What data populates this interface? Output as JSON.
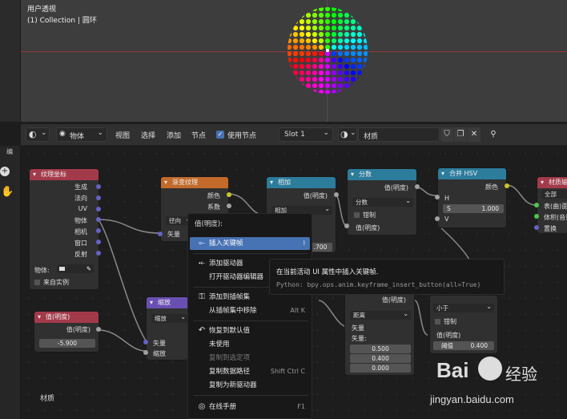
{
  "viewport": {
    "title": "用户透视",
    "subtitle": "(1) Collection | 圆环"
  },
  "header": {
    "editor_type_icon": "node-editor-icon",
    "object_label": "物体",
    "menu_view": "视图",
    "menu_select": "选择",
    "menu_add": "添加",
    "menu_node": "节点",
    "use_nodes_label": "使用节点",
    "use_nodes_checked": true,
    "slot_label": "Slot 1",
    "material_name": "材质"
  },
  "left_toolbar": {
    "item_label": "编"
  },
  "nodes": {
    "texcoord": {
      "title": "纹理坐标",
      "outputs": [
        "生成",
        "法向",
        "UV",
        "物体",
        "相机",
        "窗口",
        "反射"
      ],
      "object_label": "物体:",
      "instancer_label": "来自实例",
      "color": "#a33a4a"
    },
    "gradient": {
      "title": "渐变纹理",
      "outputs": [
        "颜色",
        "系数"
      ],
      "type_value": "径向",
      "input": "矢量",
      "color": "#c26a2a"
    },
    "value1": {
      "title": "值(明度)",
      "output": "值(明度)",
      "value": "-5.900",
      "color": "#a33a4a"
    },
    "scale": {
      "title": "缩放",
      "mode": "缩放",
      "inputs": [
        "矢量",
        "缩放"
      ],
      "color": "#6a4fb3"
    },
    "add": {
      "title": "相加",
      "output": "值(明度)",
      "mode": "相加",
      "value_field": ".700",
      "color": "#2c7c9c"
    },
    "fraction": {
      "title": "分数",
      "output": "值(明度)",
      "mode": "分数",
      "clamp_label": "钳制",
      "input": "值(明度)",
      "color": "#2c7c9c"
    },
    "combine_hsv": {
      "title": "合并 HSV",
      "output": "颜色",
      "inputs": [
        "H",
        "S",
        "V"
      ],
      "s_value": "1.000",
      "color": "#2c7c9c"
    },
    "material_output": {
      "title": "材质输出",
      "target": "全部",
      "inputs": [
        "表(曲)面",
        "体积(音量)",
        "置换"
      ],
      "color": "#a33a4a"
    },
    "distance": {
      "output": "值(明度)",
      "mode": "距离",
      "inputs": [
        "矢量",
        "矢量:"
      ],
      "vector_values": [
        "0.500",
        "0.400",
        "0.000"
      ]
    },
    "less_than": {
      "mode": "小于",
      "clamp_label": "钳制",
      "inputs": [
        "值(明度)"
      ],
      "threshold_label": "阈值",
      "threshold_value": "0.400"
    }
  },
  "bottom_label": "材质",
  "context_menu": {
    "title": "值(明度):",
    "items": [
      {
        "label": "插入关键帧",
        "shortcut": "I",
        "icon": "keyframe-icon",
        "active": true
      },
      {
        "label": "添加驱动器",
        "shortcut": "",
        "icon": "driver-icon"
      },
      {
        "label": "打开驱动器编辑器",
        "shortcut": "",
        "icon": ""
      },
      {
        "label": "添加到插帧集",
        "shortcut": "",
        "icon": "keying-set-icon"
      },
      {
        "label": "从插帧集中移除",
        "shortcut": "Alt K",
        "icon": ""
      },
      {
        "label": "恢复到默认值",
        "shortcut": "",
        "icon": "reset-icon"
      },
      {
        "label": "未使用",
        "shortcut": "",
        "icon": ""
      },
      {
        "label": "复制到选定项",
        "shortcut": "",
        "icon": "",
        "dim": true
      },
      {
        "label": "复制数据路径",
        "shortcut": "Shift Ctrl C",
        "icon": ""
      },
      {
        "label": "复制为新驱动器",
        "shortcut": "",
        "icon": ""
      },
      {
        "label": "在线手册",
        "shortcut": "F1",
        "icon": "help-icon"
      }
    ]
  },
  "tooltip": {
    "description": "在当前活动 UI 属性中插入关键帧.",
    "python": "Python: bpy.ops.anim.keyframe_insert_button(all=True)"
  },
  "watermark": {
    "brand": "Bai",
    "brand_suffix": "经验",
    "url": "jingyan.baidu.com"
  }
}
